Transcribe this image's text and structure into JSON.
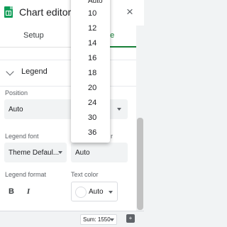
{
  "header": {
    "title": "Chart editor",
    "close_glyph": "×"
  },
  "tabs": [
    {
      "label": "Setup"
    },
    {
      "label": "mize"
    }
  ],
  "legend_section": {
    "title": "Legend",
    "position_label": "Position",
    "position_value": "Auto",
    "font_label": "Legend font",
    "font_value": "Theme Defaul...",
    "font_size_label_partial": "r",
    "font_size_value": "Auto",
    "format_label": "Legend format",
    "bold": "B",
    "italic": "I",
    "text_color_label": "Text color",
    "text_color_value": "Auto"
  },
  "font_size_menu": {
    "partial_top": "Auto",
    "items": [
      "10",
      "12",
      "14",
      "16",
      "18",
      "20",
      "24",
      "30",
      "36"
    ]
  },
  "status_bar": {
    "sum": "Sum: 1550"
  },
  "colors": {
    "accent": "#188038",
    "sheets": "#0f9d58"
  },
  "icons": [
    "sheets-logo-icon",
    "close-icon",
    "chevron-down-icon",
    "caret-down-icon",
    "explore-icon"
  ]
}
